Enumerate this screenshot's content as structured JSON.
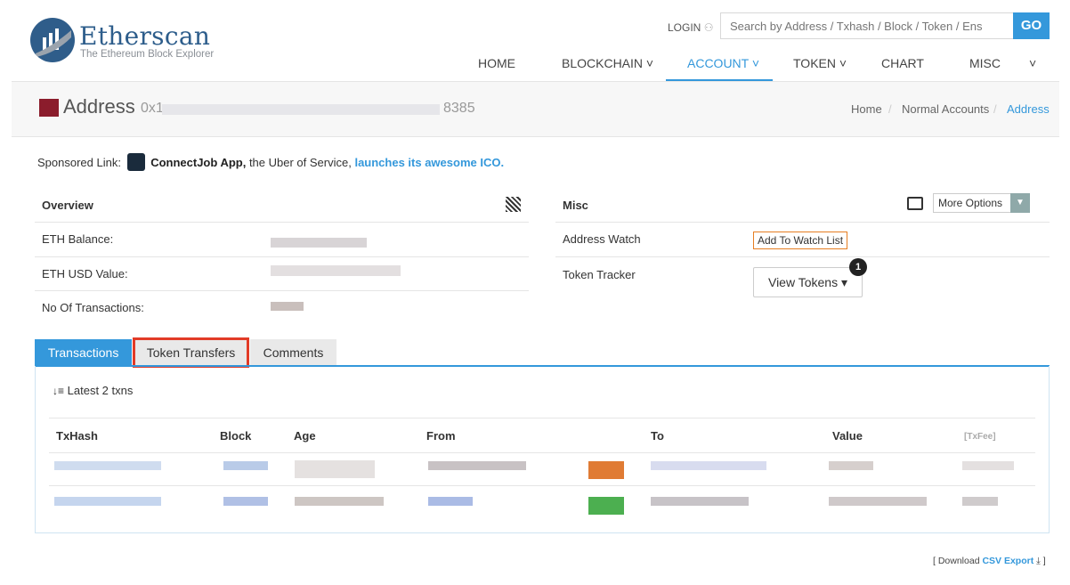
{
  "header": {
    "logo_title": "Etherscan",
    "logo_subtitle": "The Ethereum Block Explorer",
    "login_label": "LOGIN",
    "search_placeholder": "Search by Address / Txhash / Block / Token / Ens",
    "go_label": "GO",
    "nav": [
      {
        "label": "HOME"
      },
      {
        "label": "BLOCKCHAIN ˅"
      },
      {
        "label": "ACCOUNT ˅"
      },
      {
        "label": "TOKEN ˅"
      },
      {
        "label": "CHART"
      },
      {
        "label": "MISC"
      }
    ],
    "misc_caret": "˅"
  },
  "title": {
    "label": "Address",
    "address_prefix": "0x1",
    "address_suffix": "8385",
    "breadcrumb": [
      "Home",
      "Normal Accounts",
      "Address"
    ],
    "breadcrumb_sep": "/"
  },
  "sponsored": {
    "prefix": "Sponsored Link:",
    "brand": "ConnectJob App,",
    "middle": " the Uber of Service, ",
    "link": "launches its awesome ICO."
  },
  "overview": {
    "heading": "Overview",
    "rows": [
      {
        "label": "ETH Balance:"
      },
      {
        "label": "ETH USD Value:"
      },
      {
        "label": "No Of Transactions:"
      }
    ]
  },
  "misc": {
    "heading": "Misc",
    "more_options_label": "More Options",
    "address_watch_label": "Address Watch",
    "add_watch_label": "Add To Watch List",
    "token_tracker_label": "Token Tracker",
    "view_tokens_label": "View Tokens ▾",
    "token_badge": "1"
  },
  "tabs": [
    {
      "label": "Transactions"
    },
    {
      "label": "Token Transfers"
    },
    {
      "label": "Comments"
    }
  ],
  "transactions": {
    "latest_label": "Latest 2 txns",
    "columns": [
      "TxHash",
      "Block",
      "Age",
      "From",
      "To",
      "Value",
      "[TxFee]"
    ]
  },
  "footer": {
    "csv_prefix": "[ Download ",
    "csv_link": "CSV Export",
    "csv_suffix": " ⤓ ]"
  },
  "colors": {
    "accent": "#3498db",
    "highlight_box": "#e23b27",
    "watch_border": "#e67e22"
  }
}
